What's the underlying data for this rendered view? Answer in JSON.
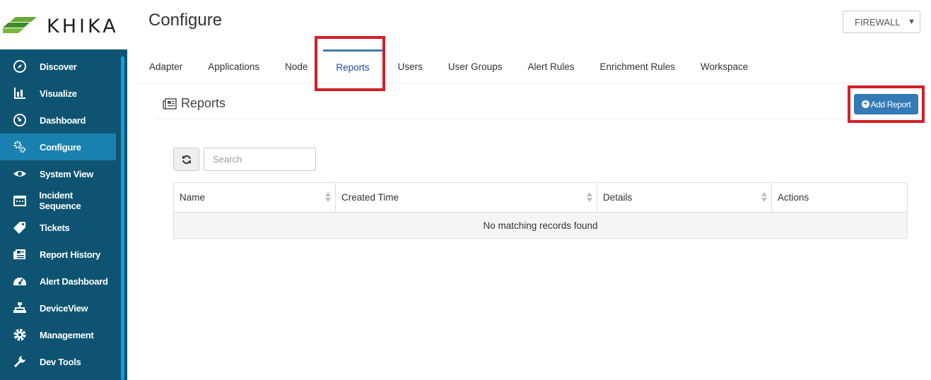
{
  "brand": {
    "name": "KHIKA"
  },
  "sidebar": {
    "items": [
      {
        "label": "Discover",
        "icon": "compass-icon",
        "active": false
      },
      {
        "label": "Visualize",
        "icon": "bar-chart-icon",
        "active": false
      },
      {
        "label": "Dashboard",
        "icon": "gauge-icon",
        "active": false
      },
      {
        "label": "Configure",
        "icon": "gears-icon",
        "active": true
      },
      {
        "label": "System View",
        "icon": "eye-icon",
        "active": false
      },
      {
        "label": "Incident Sequence",
        "icon": "calendar-icon",
        "active": false
      },
      {
        "label": "Tickets",
        "icon": "tag-icon",
        "active": false
      },
      {
        "label": "Report History",
        "icon": "newspaper-icon",
        "active": false
      },
      {
        "label": "Alert Dashboard",
        "icon": "dashboard-icon",
        "active": false
      },
      {
        "label": "DeviceView",
        "icon": "sitemap-icon",
        "active": false
      },
      {
        "label": "Management",
        "icon": "gear-icon",
        "active": false
      },
      {
        "label": "Dev Tools",
        "icon": "wrench-icon",
        "active": false
      }
    ]
  },
  "header": {
    "title": "Configure",
    "device_select": {
      "value": "FIREWALL"
    }
  },
  "tabs": [
    {
      "label": "Adapter",
      "active": false
    },
    {
      "label": "Applications",
      "active": false
    },
    {
      "label": "Node",
      "active": false
    },
    {
      "label": "Reports",
      "active": true
    },
    {
      "label": "Users",
      "active": false
    },
    {
      "label": "User Groups",
      "active": false
    },
    {
      "label": "Alert Rules",
      "active": false
    },
    {
      "label": "Enrichment Rules",
      "active": false
    },
    {
      "label": "Workspace",
      "active": false
    }
  ],
  "reports": {
    "title": "Reports",
    "add_button": "Add Report",
    "search": {
      "placeholder": "Search",
      "value": ""
    },
    "table": {
      "columns": [
        {
          "label": "Name",
          "sortable": true
        },
        {
          "label": "Created Time",
          "sortable": true
        },
        {
          "label": "Details",
          "sortable": true
        },
        {
          "label": "Actions",
          "sortable": false
        }
      ],
      "empty_message": "No matching records found"
    }
  },
  "colors": {
    "sidebar_bg": "#0e5472",
    "sidebar_active": "#1981b0",
    "primary_button": "#337ab7",
    "highlight": "#d21f26",
    "tab_active_text": "#1f4aa8"
  }
}
